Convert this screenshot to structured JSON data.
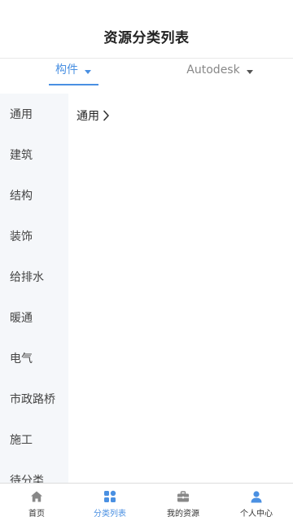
{
  "header": {
    "title": "资源分类列表"
  },
  "filters": [
    {
      "label": "构件",
      "active": true
    },
    {
      "label": "Autodesk",
      "active": false
    }
  ],
  "sidebar": {
    "items": [
      "通用",
      "建筑",
      "结构",
      "装饰",
      "给排水",
      "暖通",
      "电气",
      "市政路桥",
      "施工",
      "待分类"
    ]
  },
  "content": {
    "breadcrumb": "通用"
  },
  "tabbar": {
    "tabs": [
      {
        "label": "首页",
        "icon": "home-icon"
      },
      {
        "label": "分类列表",
        "icon": "grid-icon"
      },
      {
        "label": "我的资源",
        "icon": "briefcase-icon"
      },
      {
        "label": "个人中心",
        "icon": "person-icon"
      }
    ]
  },
  "colors": {
    "accent": "#4a90e2",
    "sidebar_bg": "#f5f7fa",
    "icon_gray": "#888888"
  }
}
